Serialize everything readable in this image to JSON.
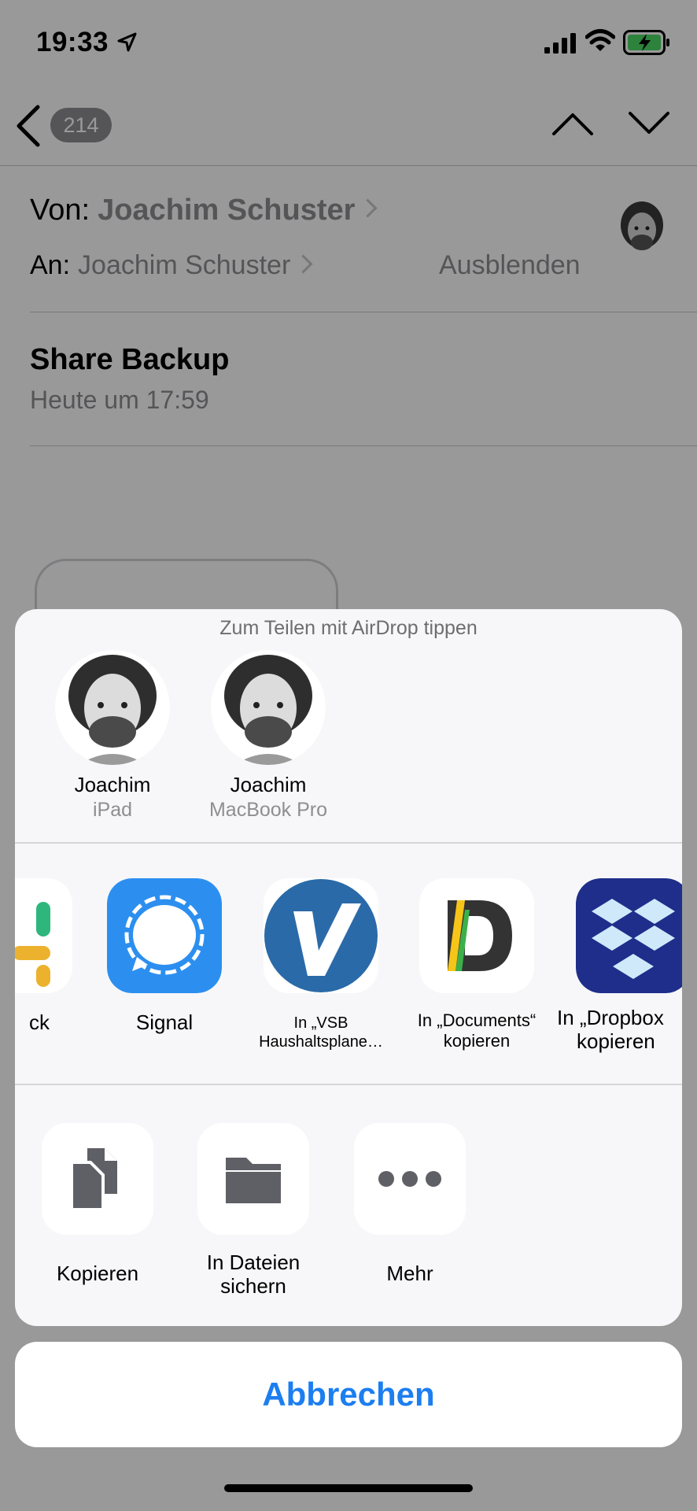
{
  "status_bar": {
    "time": "19:33"
  },
  "nav": {
    "back_count": "214"
  },
  "mail": {
    "from_label": "Von:",
    "from_name": "Joachim Schuster",
    "to_label": "An:",
    "to_name": "Joachim Schuster",
    "hide_label": "Ausblenden",
    "subject": "Share Backup",
    "date": "Heute um 17:59"
  },
  "share_sheet": {
    "airdrop_hint": "Zum Teilen mit AirDrop tippen",
    "airdrop_people": [
      {
        "name": "Joachim",
        "device": "iPad"
      },
      {
        "name": "Joachim",
        "device": "MacBook Pro"
      }
    ],
    "apps": [
      {
        "label": "ck",
        "icon": "slack-icon"
      },
      {
        "label": "Signal",
        "icon": "signal-icon"
      },
      {
        "label_line1": "In „VSB",
        "label_line2": "Haushaltsplane…",
        "icon": "vsb-icon"
      },
      {
        "label_line1": "In „Documents“",
        "label_line2": "kopieren",
        "icon": "documents-icon"
      },
      {
        "label_line1": "In „Dropbox",
        "label_line2": "kopieren",
        "icon": "dropbox-icon"
      }
    ],
    "actions": [
      {
        "label": "Kopieren",
        "icon": "copy-icon"
      },
      {
        "label_line1": "In Dateien",
        "label_line2": "sichern",
        "icon": "folder-icon"
      },
      {
        "label": "Mehr",
        "icon": "more-icon"
      }
    ],
    "cancel_label": "Abbrechen"
  },
  "colors": {
    "ios_blue": "#1c7ef0",
    "signal_blue": "#2c8ff0",
    "vsb_blue": "#2a6aa8",
    "dropbox_navy": "#1e2e8a",
    "battery_green": "#4cd964"
  }
}
